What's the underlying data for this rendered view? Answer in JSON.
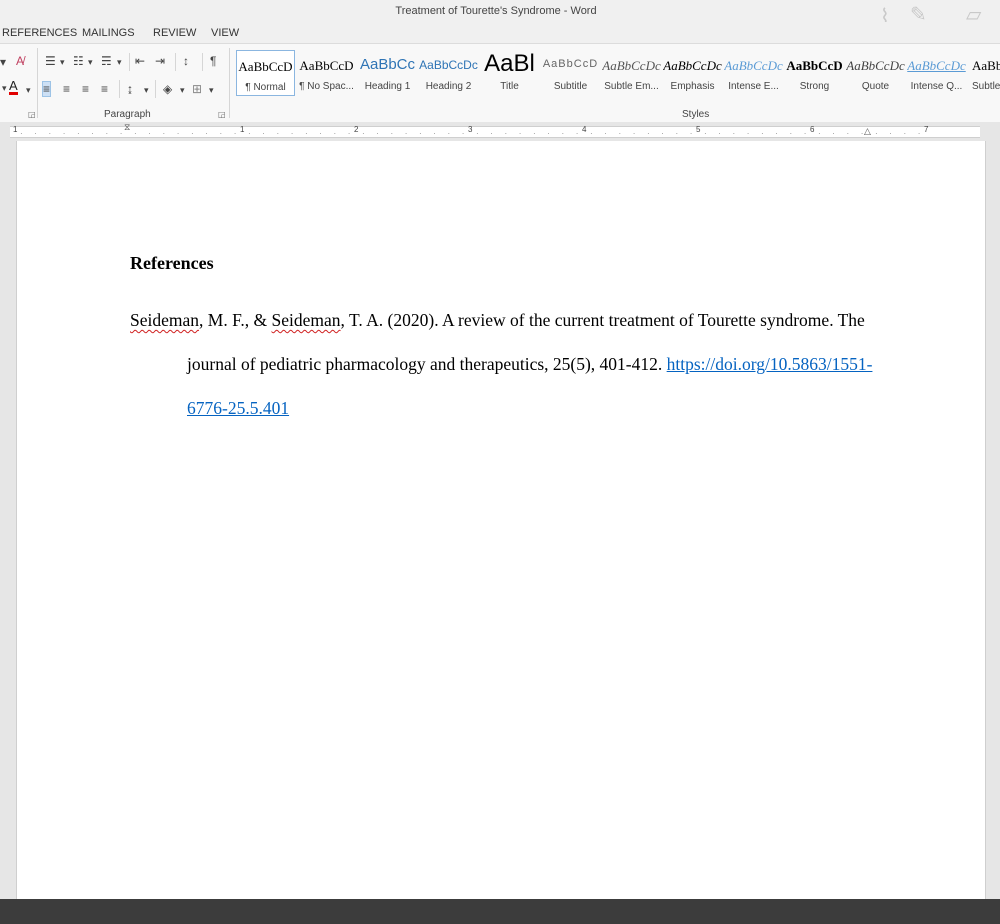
{
  "window": {
    "title": "Treatment of Tourette's Syndrome - Word"
  },
  "tabs": [
    "REFERENCES",
    "MAILINGS",
    "REVIEW",
    "VIEW"
  ],
  "ribbon": {
    "paragraph_group_label": "Paragraph",
    "styles_group_label": "Styles",
    "styles": [
      {
        "sample": "AaBbCcD",
        "name": "¶ Normal"
      },
      {
        "sample": "AaBbCcD",
        "name": "¶ No Spac..."
      },
      {
        "sample": "AaBbCc",
        "name": "Heading 1"
      },
      {
        "sample": "AaBbCcDc",
        "name": "Heading 2"
      },
      {
        "sample": "AaBl",
        "name": "Title"
      },
      {
        "sample": "AaBbCcD",
        "name": "Subtitle"
      },
      {
        "sample": "AaBbCcDc",
        "name": "Subtle Em..."
      },
      {
        "sample": "AaBbCcDc",
        "name": "Emphasis"
      },
      {
        "sample": "AaBbCcDc",
        "name": "Intense E..."
      },
      {
        "sample": "AaBbCcD",
        "name": "Strong"
      },
      {
        "sample": "AaBbCcDc",
        "name": "Quote"
      },
      {
        "sample": "AaBbCcDc",
        "name": "Intense Q..."
      },
      {
        "sample": "AaBb",
        "name": "Subtle"
      }
    ]
  },
  "ruler": {
    "numbers": [
      "1",
      "1",
      "2",
      "3",
      "4",
      "5",
      "6",
      "7"
    ]
  },
  "document": {
    "heading": "References",
    "reference": {
      "author1": "Seideman",
      "t1": ", M. F., & ",
      "author2": "Seideman",
      "t2": ", T. A. (2020). A review of the current treatment of Tourette syndrome. The",
      "line2_text": "journal of pediatric pharmacology and therapeutics, 25(5), 401-412. ",
      "link_part1": "https://doi.org/10.5863/1551-",
      "link_part2": "6776-25.5.401"
    }
  },
  "colors": {
    "link": "#0563c1",
    "spell_error": "#d02020",
    "page": "#ffffff",
    "status_bar": "#3c3c3c"
  }
}
